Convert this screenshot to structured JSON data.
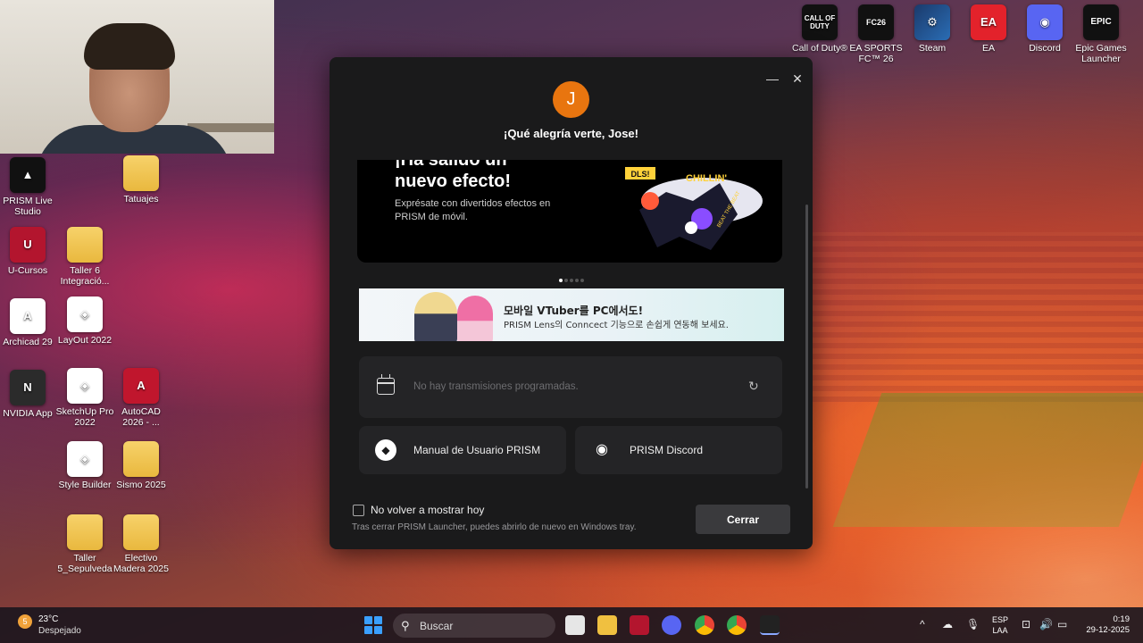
{
  "desktop": {
    "icons_left": [
      {
        "label": "PRISM Live Studio",
        "glyph": "▲"
      },
      {
        "label": "Tatuajes",
        "glyph": ""
      },
      {
        "label": "U-Cursos",
        "glyph": "U"
      },
      {
        "label": "Taller 6 Integració...",
        "glyph": ""
      },
      {
        "label": "Archicad 29",
        "glyph": "A"
      },
      {
        "label": "LayOut 2022",
        "glyph": "◈"
      },
      {
        "label": "NVIDIA App",
        "glyph": "N"
      },
      {
        "label": "SketchUp Pro 2022",
        "glyph": "◈"
      },
      {
        "label": "AutoCAD 2026 - ...",
        "glyph": "A"
      },
      {
        "label": "Style Builder",
        "glyph": "◈"
      },
      {
        "label": "Sismo 2025",
        "glyph": ""
      },
      {
        "label": "Taller 5_Sepulveda",
        "glyph": ""
      },
      {
        "label": "Electivo Madera 2025",
        "glyph": ""
      }
    ],
    "icons_top": [
      {
        "label": "Call of Duty®",
        "glyph": "CALL OF DUTY"
      },
      {
        "label": "EA SPORTS FC™ 26",
        "glyph": "FC26"
      },
      {
        "label": "Steam",
        "glyph": "⚙"
      },
      {
        "label": "EA",
        "glyph": "EA"
      },
      {
        "label": "Discord",
        "glyph": "◉"
      },
      {
        "label": "Epic Games Launcher",
        "glyph": "EPIC"
      }
    ]
  },
  "launcher": {
    "minimize_glyph": "—",
    "close_glyph": "✕",
    "avatar_initial": "J",
    "greeting": "¡Qué alegría verte, Jose!",
    "banner": {
      "title_line1": "¡Ha salido un",
      "title_line2": "nuevo efecto!",
      "description": "Exprésate con divertidos efectos en PRISM de móvil.",
      "sticker_text1": "DLS!",
      "sticker_text2": "CHILLIN'",
      "sticker_text3": "BEAT THE BEAT"
    },
    "carousel_dots": 5,
    "vtuber": {
      "title": "모바일 VTuber를 PC에서도!",
      "subtitle": "PRISM Lens의 Conncect 기능으로 손쉽게 연동해 보세요."
    },
    "schedule": {
      "empty_message": "No hay transmisiones programadas.",
      "refresh_glyph": "↻"
    },
    "links": [
      {
        "label": "Manual de Usuario PRISM",
        "icon": "◆"
      },
      {
        "label": "PRISM Discord",
        "icon": "◉"
      }
    ],
    "footer": {
      "checkbox_label": "No volver a mostrar hoy",
      "note": "Tras cerrar PRISM Launcher, puedes abrirlo de nuevo en Windows tray.",
      "close_label": "Cerrar"
    }
  },
  "taskbar": {
    "weather_temp": "23°C",
    "weather_desc": "Despejado",
    "weather_badge": "5",
    "search_placeholder": "Buscar",
    "lang_line1": "ESP",
    "lang_line2": "LAA",
    "time": "0:19",
    "date": "29-12-2025",
    "tray_icons": [
      "^",
      "☁",
      "🎙",
      "⊡",
      "🔊",
      "▭"
    ]
  },
  "colors": {
    "avatar": "#e8750f",
    "window_bg": "#1a1a1b",
    "card_bg": "#242426",
    "discord": "#5865f2"
  }
}
